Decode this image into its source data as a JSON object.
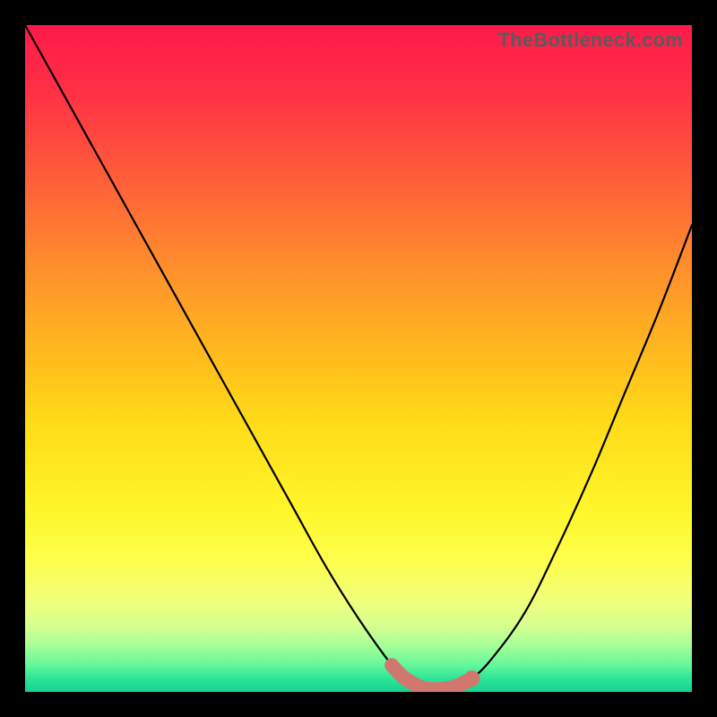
{
  "watermark": {
    "text": "TheBottleneck.com"
  },
  "chart_data": {
    "type": "line",
    "title": "",
    "xlabel": "",
    "ylabel": "",
    "xlim": [
      0,
      100
    ],
    "ylim": [
      0,
      100
    ],
    "x": [
      0,
      5,
      10,
      15,
      20,
      25,
      30,
      35,
      40,
      45,
      50,
      55,
      57,
      60,
      63,
      65,
      67,
      70,
      75,
      80,
      85,
      90,
      95,
      100
    ],
    "series": [
      {
        "name": "bottleneck-curve",
        "values": [
          100,
          91,
          82,
          73,
          64,
          55,
          46,
          37,
          28,
          19,
          11,
          4,
          2,
          0.5,
          0.5,
          1,
          2,
          5,
          12,
          22,
          33,
          45,
          57,
          70
        ]
      }
    ],
    "highlight": {
      "range_x": [
        55,
        67
      ],
      "color": "#d2776f"
    },
    "background_gradient": {
      "stops": [
        {
          "pos": 0.0,
          "color": "#ff1a4b"
        },
        {
          "pos": 0.1,
          "color": "#ff3045"
        },
        {
          "pos": 0.22,
          "color": "#ff5a3a"
        },
        {
          "pos": 0.35,
          "color": "#ff8a2e"
        },
        {
          "pos": 0.48,
          "color": "#ffb61f"
        },
        {
          "pos": 0.6,
          "color": "#ffdc18"
        },
        {
          "pos": 0.72,
          "color": "#fff529"
        },
        {
          "pos": 0.8,
          "color": "#fdff4a"
        },
        {
          "pos": 0.86,
          "color": "#f3ff79"
        },
        {
          "pos": 0.9,
          "color": "#d7ff8f"
        },
        {
          "pos": 0.93,
          "color": "#a7ff97"
        },
        {
          "pos": 0.96,
          "color": "#63f79a"
        },
        {
          "pos": 0.98,
          "color": "#2de598"
        },
        {
          "pos": 1.0,
          "color": "#12d38f"
        }
      ]
    }
  }
}
